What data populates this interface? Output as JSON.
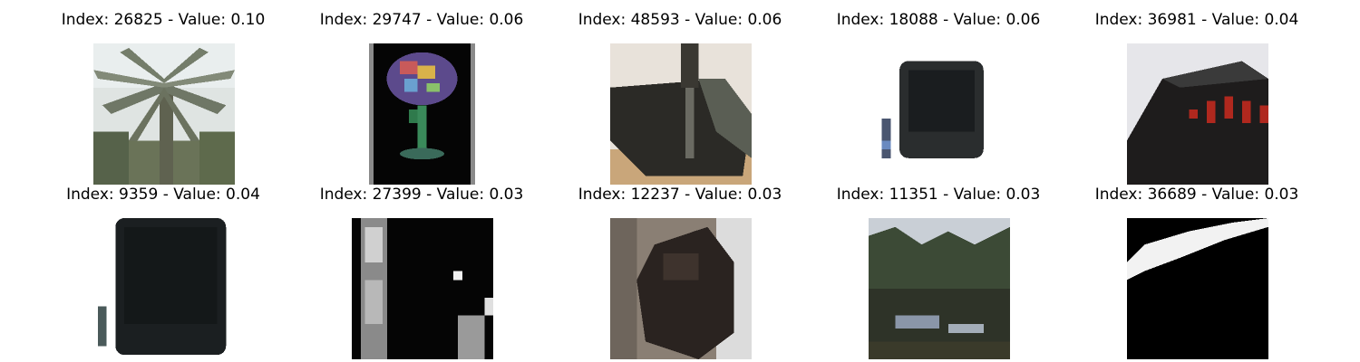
{
  "items": [
    {
      "title": "Index: 26825 - Value: 0.10",
      "subject": "palm-tree"
    },
    {
      "title": "Index: 29747 - Value: 0.06",
      "subject": "colorful-glass"
    },
    {
      "title": "Index: 48593 - Value: 0.06",
      "subject": "dark-box"
    },
    {
      "title": "Index: 18088 - Value: 0.06",
      "subject": "television"
    },
    {
      "title": "Index: 36981 - Value: 0.04",
      "subject": "alarm-clock"
    },
    {
      "title": "Index: 9359 - Value: 0.04",
      "subject": "television"
    },
    {
      "title": "Index: 27399 - Value: 0.03",
      "subject": "monochrome-scene"
    },
    {
      "title": "Index: 12237 - Value: 0.03",
      "subject": "dark-animal"
    },
    {
      "title": "Index: 11351 - Value: 0.03",
      "subject": "lake-reflection"
    },
    {
      "title": "Index: 36689 - Value: 0.03",
      "subject": "white-streak"
    }
  ]
}
